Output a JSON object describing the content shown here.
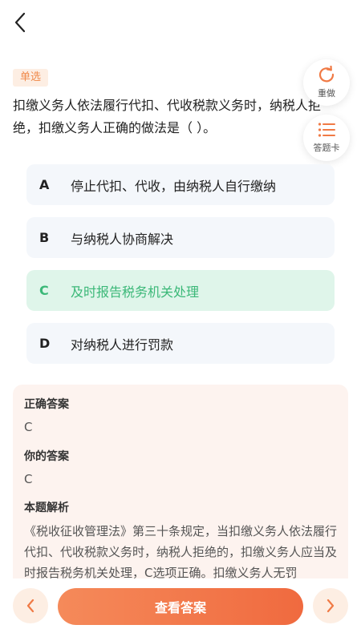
{
  "header": {
    "back_icon": "chevron-left-icon"
  },
  "question": {
    "type_tag": "单选",
    "text": "扣缴义务人依法履行代扣、代收税款义务时，纳税人拒绝，扣缴义务人正确的做法是（ ）。"
  },
  "side_actions": {
    "redo_label": "重做",
    "redo_icon": "refresh-icon",
    "card_label": "答题卡",
    "card_icon": "list-icon"
  },
  "options": [
    {
      "letter": "A",
      "text": "停止代扣、代收，由纳税人自行缴纳",
      "state": "normal"
    },
    {
      "letter": "B",
      "text": "与纳税人协商解决",
      "state": "normal"
    },
    {
      "letter": "C",
      "text": "及时报告税务机关处理",
      "state": "correct"
    },
    {
      "letter": "D",
      "text": "对纳税人进行罚款",
      "state": "normal"
    }
  ],
  "explanation": {
    "correct_answer_label": "正确答案",
    "correct_answer": "C",
    "your_answer_label": "你的答案",
    "your_answer": "C",
    "analysis_label": "本题解析",
    "analysis_text": "《税收征收管理法》第三十条规定，当扣缴义务人依法履行代扣、代收税款义务时，纳税人拒绝的，扣缴义务人应当及时报告税务机关处理，C选项正确。扣缴义务人无罚"
  },
  "bottom_bar": {
    "prev_icon": "chevron-left-icon",
    "next_icon": "chevron-right-icon",
    "view_answer_label": "查看答案"
  },
  "colors": {
    "accent": "#f06a3f",
    "correct": "#3bb878",
    "tag_bg": "#fdeee3",
    "explain_bg": "#fdf3ef"
  }
}
